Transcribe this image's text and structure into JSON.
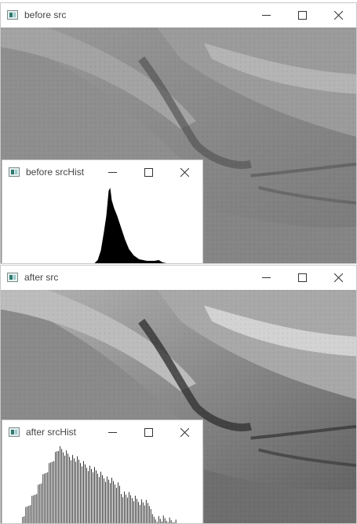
{
  "windows": {
    "before_src": {
      "title": "before src"
    },
    "before_hist": {
      "title": "before srcHist"
    },
    "after_src": {
      "title": "after src"
    },
    "after_hist": {
      "title": "after srcHist"
    }
  },
  "icons": {
    "app": "opencv-window-icon",
    "minimize": "minimize-icon",
    "maximize": "maximize-icon",
    "close": "close-icon"
  },
  "colors": {
    "titlebar": "#ffffff",
    "window_border": "#c9c9c9",
    "histogram_fill": "#000000",
    "histogram_background": "#ffffff"
  }
}
